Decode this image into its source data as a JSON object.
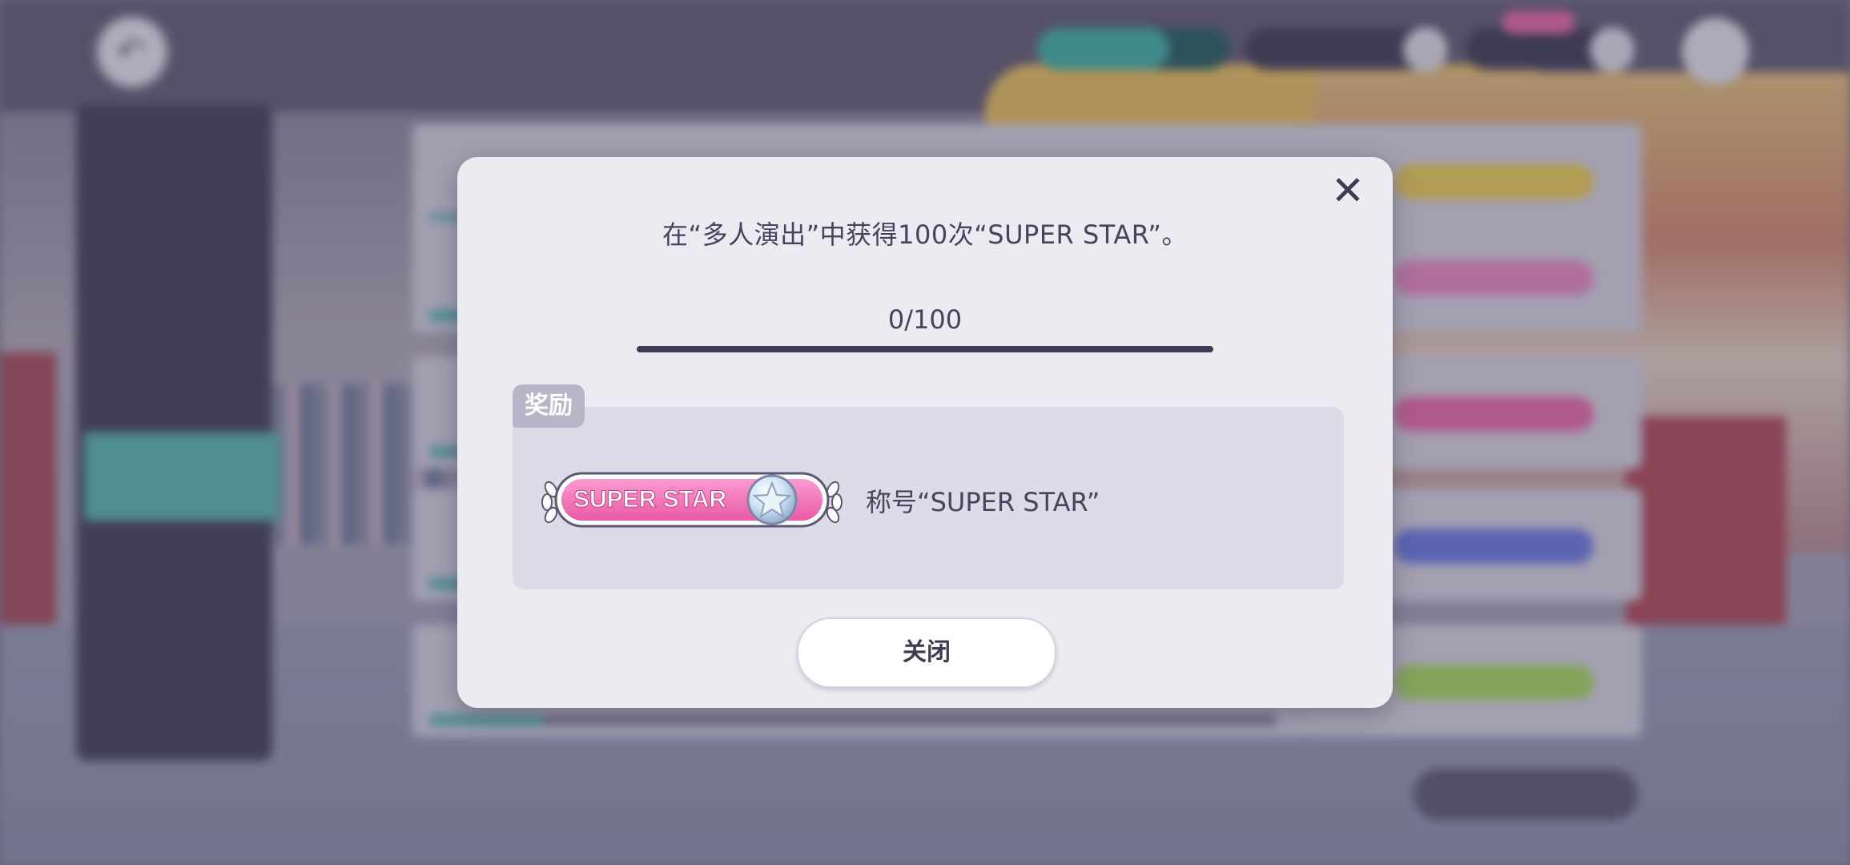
{
  "dialog": {
    "description": "在“多人演出”中获得100次“SUPER STAR”。",
    "progress_text": "0/100",
    "progress_fraction": 0,
    "reward_tag": "奖励",
    "reward_badge_text": "SUPER STAR",
    "reward_name": "称号“SUPER STAR”",
    "close_button_label": "关闭",
    "close_icon": "close-icon"
  },
  "colors": {
    "dialog_bg": "#ecebf2",
    "text": "#46435c",
    "accent_teal": "#56bdb0",
    "badge_pink": "#f06aa6"
  }
}
